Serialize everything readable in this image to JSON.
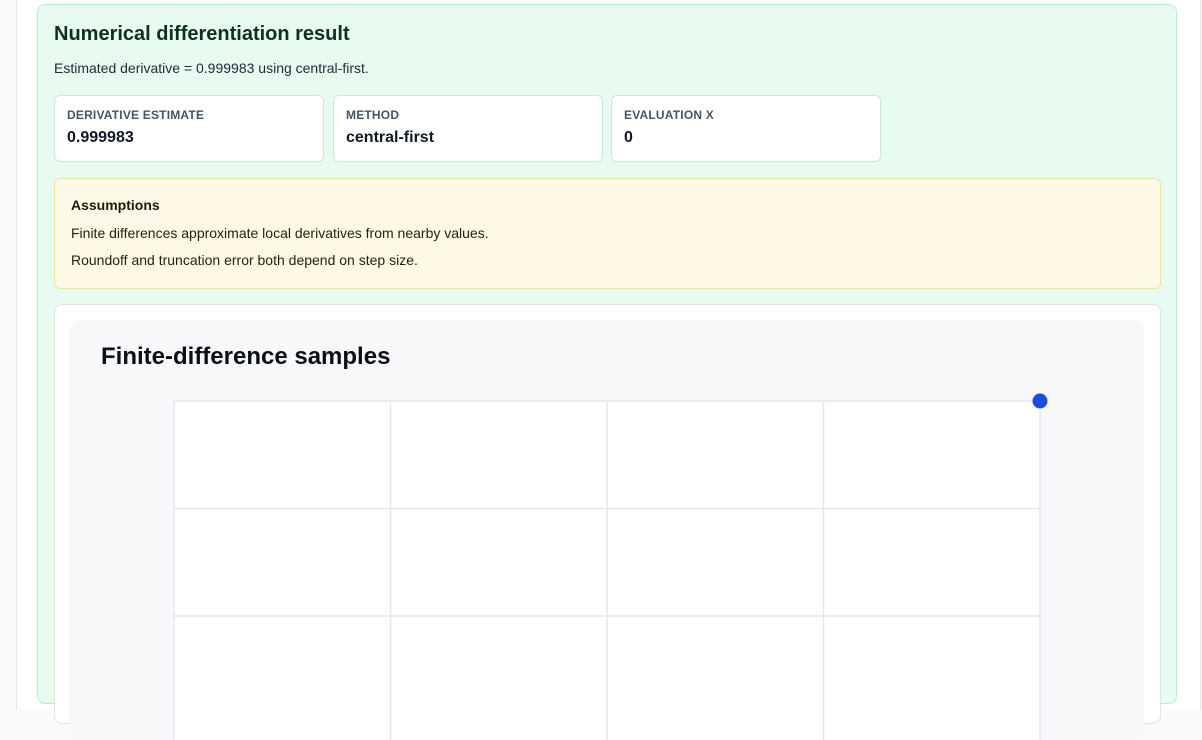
{
  "result": {
    "title": "Numerical differentiation result",
    "summary": "Estimated derivative = 0.999983 using central-first."
  },
  "metrics": [
    {
      "label": "DERIVATIVE ESTIMATE",
      "value": "0.999983"
    },
    {
      "label": "METHOD",
      "value": "central-first"
    },
    {
      "label": "EVALUATION X",
      "value": "0"
    }
  ],
  "assumptions": {
    "title": "Assumptions",
    "items": [
      "Finite differences approximate local derivatives from nearby values.",
      "Roundoff and truncation error both depend on step size."
    ]
  },
  "chart_data": {
    "type": "scatter",
    "title": "Finite-difference samples",
    "grid": true,
    "point_color": "#1d4ed8",
    "grid_color": "#e2e8f0"
  },
  "colors": {
    "success_bg": "#e8fbf1",
    "warning_bg": "#fef9e7",
    "accent": "#1d4ed8"
  }
}
